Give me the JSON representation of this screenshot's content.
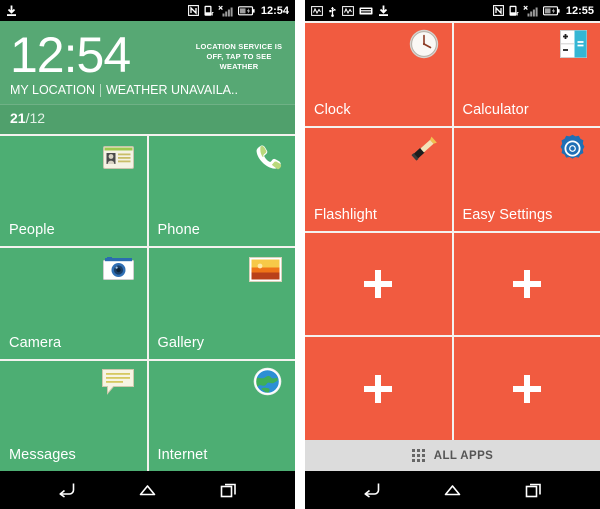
{
  "left_phone": {
    "status_bar": {
      "left_icons": [
        "download-icon"
      ],
      "right_icons": [
        "nfc-icon",
        "vibrate-phone-icon",
        "signal-no-service-icon",
        "battery-icon"
      ],
      "time": "12:54"
    },
    "weather_widget": {
      "clock": "12:54",
      "location_service_notice": "LOCATION SERVICE IS OFF, TAP TO SEE WEATHER",
      "location": "MY LOCATION",
      "weather_status": "WEATHER UNAVAILA.."
    },
    "date_strip": {
      "day": "21",
      "month": "/12"
    },
    "tiles": [
      {
        "label": "People",
        "icon": "contact-card-icon"
      },
      {
        "label": "Phone",
        "icon": "phone-handset-icon"
      },
      {
        "label": "Camera",
        "icon": "camera-icon"
      },
      {
        "label": "Gallery",
        "icon": "photo-frame-icon"
      },
      {
        "label": "Messages",
        "icon": "speech-bubble-icon"
      },
      {
        "label": "Internet",
        "icon": "globe-icon"
      }
    ],
    "nav_bar": {
      "back": "back-icon",
      "home": "home-icon",
      "recents": "recent-apps-icon"
    }
  },
  "right_phone": {
    "status_bar": {
      "left_icons": [
        "debug-icon",
        "usb-icon",
        "debug-icon",
        "keyboard-icon",
        "download-icon"
      ],
      "right_icons": [
        "nfc-icon",
        "vibrate-phone-icon",
        "signal-no-service-icon",
        "battery-icon"
      ],
      "time": "12:55"
    },
    "tiles": [
      {
        "label": "Clock",
        "icon": "analog-clock-icon",
        "empty": false
      },
      {
        "label": "Calculator",
        "icon": "calculator-icon",
        "empty": false
      },
      {
        "label": "Flashlight",
        "icon": "flashlight-icon",
        "empty": false
      },
      {
        "label": "Easy Settings",
        "icon": "gear-icon",
        "empty": false
      },
      {
        "label": "",
        "icon": "plus-icon",
        "empty": true
      },
      {
        "label": "",
        "icon": "plus-icon",
        "empty": true
      },
      {
        "label": "",
        "icon": "plus-icon",
        "empty": true
      },
      {
        "label": "",
        "icon": "plus-icon",
        "empty": true
      }
    ],
    "all_apps": {
      "label": "ALL APPS",
      "icon": "app-drawer-grid-icon"
    },
    "nav_bar": {
      "back": "back-icon",
      "home": "home-icon",
      "recents": "recent-apps-icon"
    }
  },
  "colors": {
    "green_tile": "#4dae73",
    "green_header": "#57a874",
    "green_date": "#50a06c",
    "red_tile": "#f15b40",
    "status_bar": "#000000",
    "all_apps_bar": "#dcdcdc",
    "gap": "#f4f2ef"
  }
}
